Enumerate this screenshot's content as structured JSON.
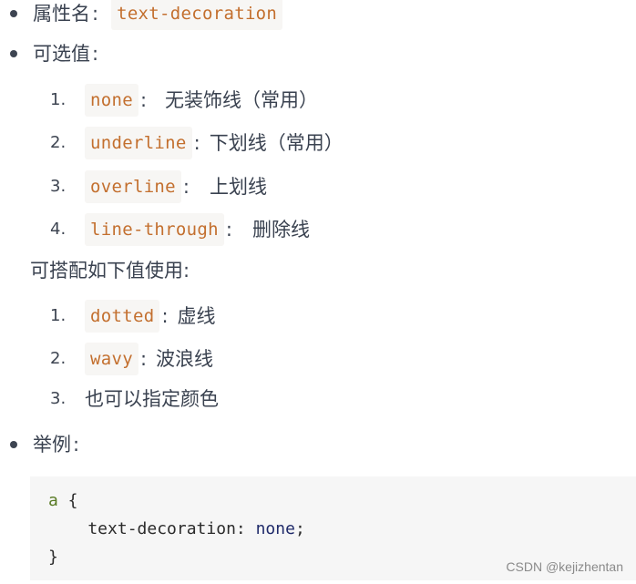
{
  "property": {
    "label": "属性名",
    "name": "text-decoration"
  },
  "values_section": {
    "label": "可选值",
    "items": [
      {
        "num": "1.",
        "code": "none",
        "desc": "无装饰线（常用）"
      },
      {
        "num": "2.",
        "code": "underline",
        "desc": "下划线（常用）"
      },
      {
        "num": "3.",
        "code": "overline",
        "desc": "上划线"
      },
      {
        "num": "4.",
        "code": "line-through",
        "desc": "删除线"
      }
    ]
  },
  "combo_section": {
    "label": "可搭配如下值使用:",
    "items": [
      {
        "num": "1.",
        "code": "dotted",
        "desc": "虚线"
      },
      {
        "num": "2.",
        "code": "wavy",
        "desc": "波浪线"
      },
      {
        "num": "3.",
        "code": "",
        "desc": "也可以指定颜色"
      }
    ]
  },
  "example_section": {
    "label": "举例",
    "code_lines": {
      "line1_selector": "a",
      "line1_brace": " {",
      "line2_prop": "    text-decoration: ",
      "line2_value": "none",
      "line2_end": ";",
      "line3": "}"
    }
  },
  "colon": "：",
  "colon_ascii": ":",
  "watermark": "CSDN @kejizhentan"
}
